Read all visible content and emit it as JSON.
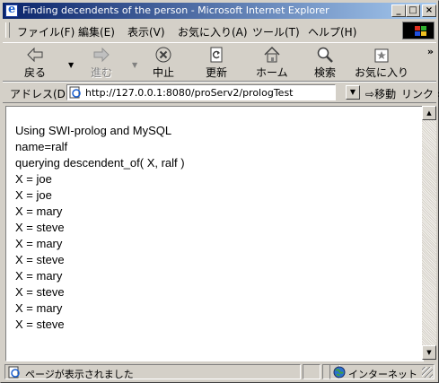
{
  "window": {
    "title": "Finding decendents of the person - Microsoft Internet Explorer",
    "controls": {
      "minimize": "_",
      "maximize": "□",
      "close": "×"
    }
  },
  "menubar": {
    "items": [
      {
        "label": "ファイル(F)"
      },
      {
        "label": "編集(E)"
      },
      {
        "label": "表示(V)"
      },
      {
        "label": "お気に入り(A)"
      },
      {
        "label": "ツール(T)"
      },
      {
        "label": "ヘルプ(H)"
      }
    ]
  },
  "toolbar": {
    "back": {
      "label": "戻る",
      "icon": "back-arrow-icon"
    },
    "forward": {
      "label": "進む",
      "icon": "forward-arrow-icon"
    },
    "stop": {
      "label": "中止",
      "icon": "stop-icon"
    },
    "refresh": {
      "label": "更新",
      "icon": "refresh-icon"
    },
    "home": {
      "label": "ホーム",
      "icon": "home-icon"
    },
    "search": {
      "label": "検索",
      "icon": "search-icon"
    },
    "favorites": {
      "label": "お気に入り",
      "icon": "favorites-icon"
    },
    "more": "»"
  },
  "addressbar": {
    "label": "アドレス(D)",
    "url": "http://127.0.0.1:8080/proServ2/prologTest",
    "go": "移動",
    "links": "リンク",
    "more": "»"
  },
  "content": {
    "lines": [
      "Using SWI-prolog and MySQL",
      "name=ralf",
      "querying descendent_of( X, ralf )",
      "X = joe",
      "X = joe",
      "X = mary",
      "X = steve",
      "X = mary",
      "X = steve",
      "X = mary",
      "X = steve",
      "X = mary",
      "X = steve"
    ]
  },
  "statusbar": {
    "text": "ページが表示されました",
    "zone": "インターネット"
  },
  "colors": {
    "titlebar_start": "#0a246a",
    "titlebar_end": "#a6caf0",
    "chrome": "#d4d0c8"
  }
}
